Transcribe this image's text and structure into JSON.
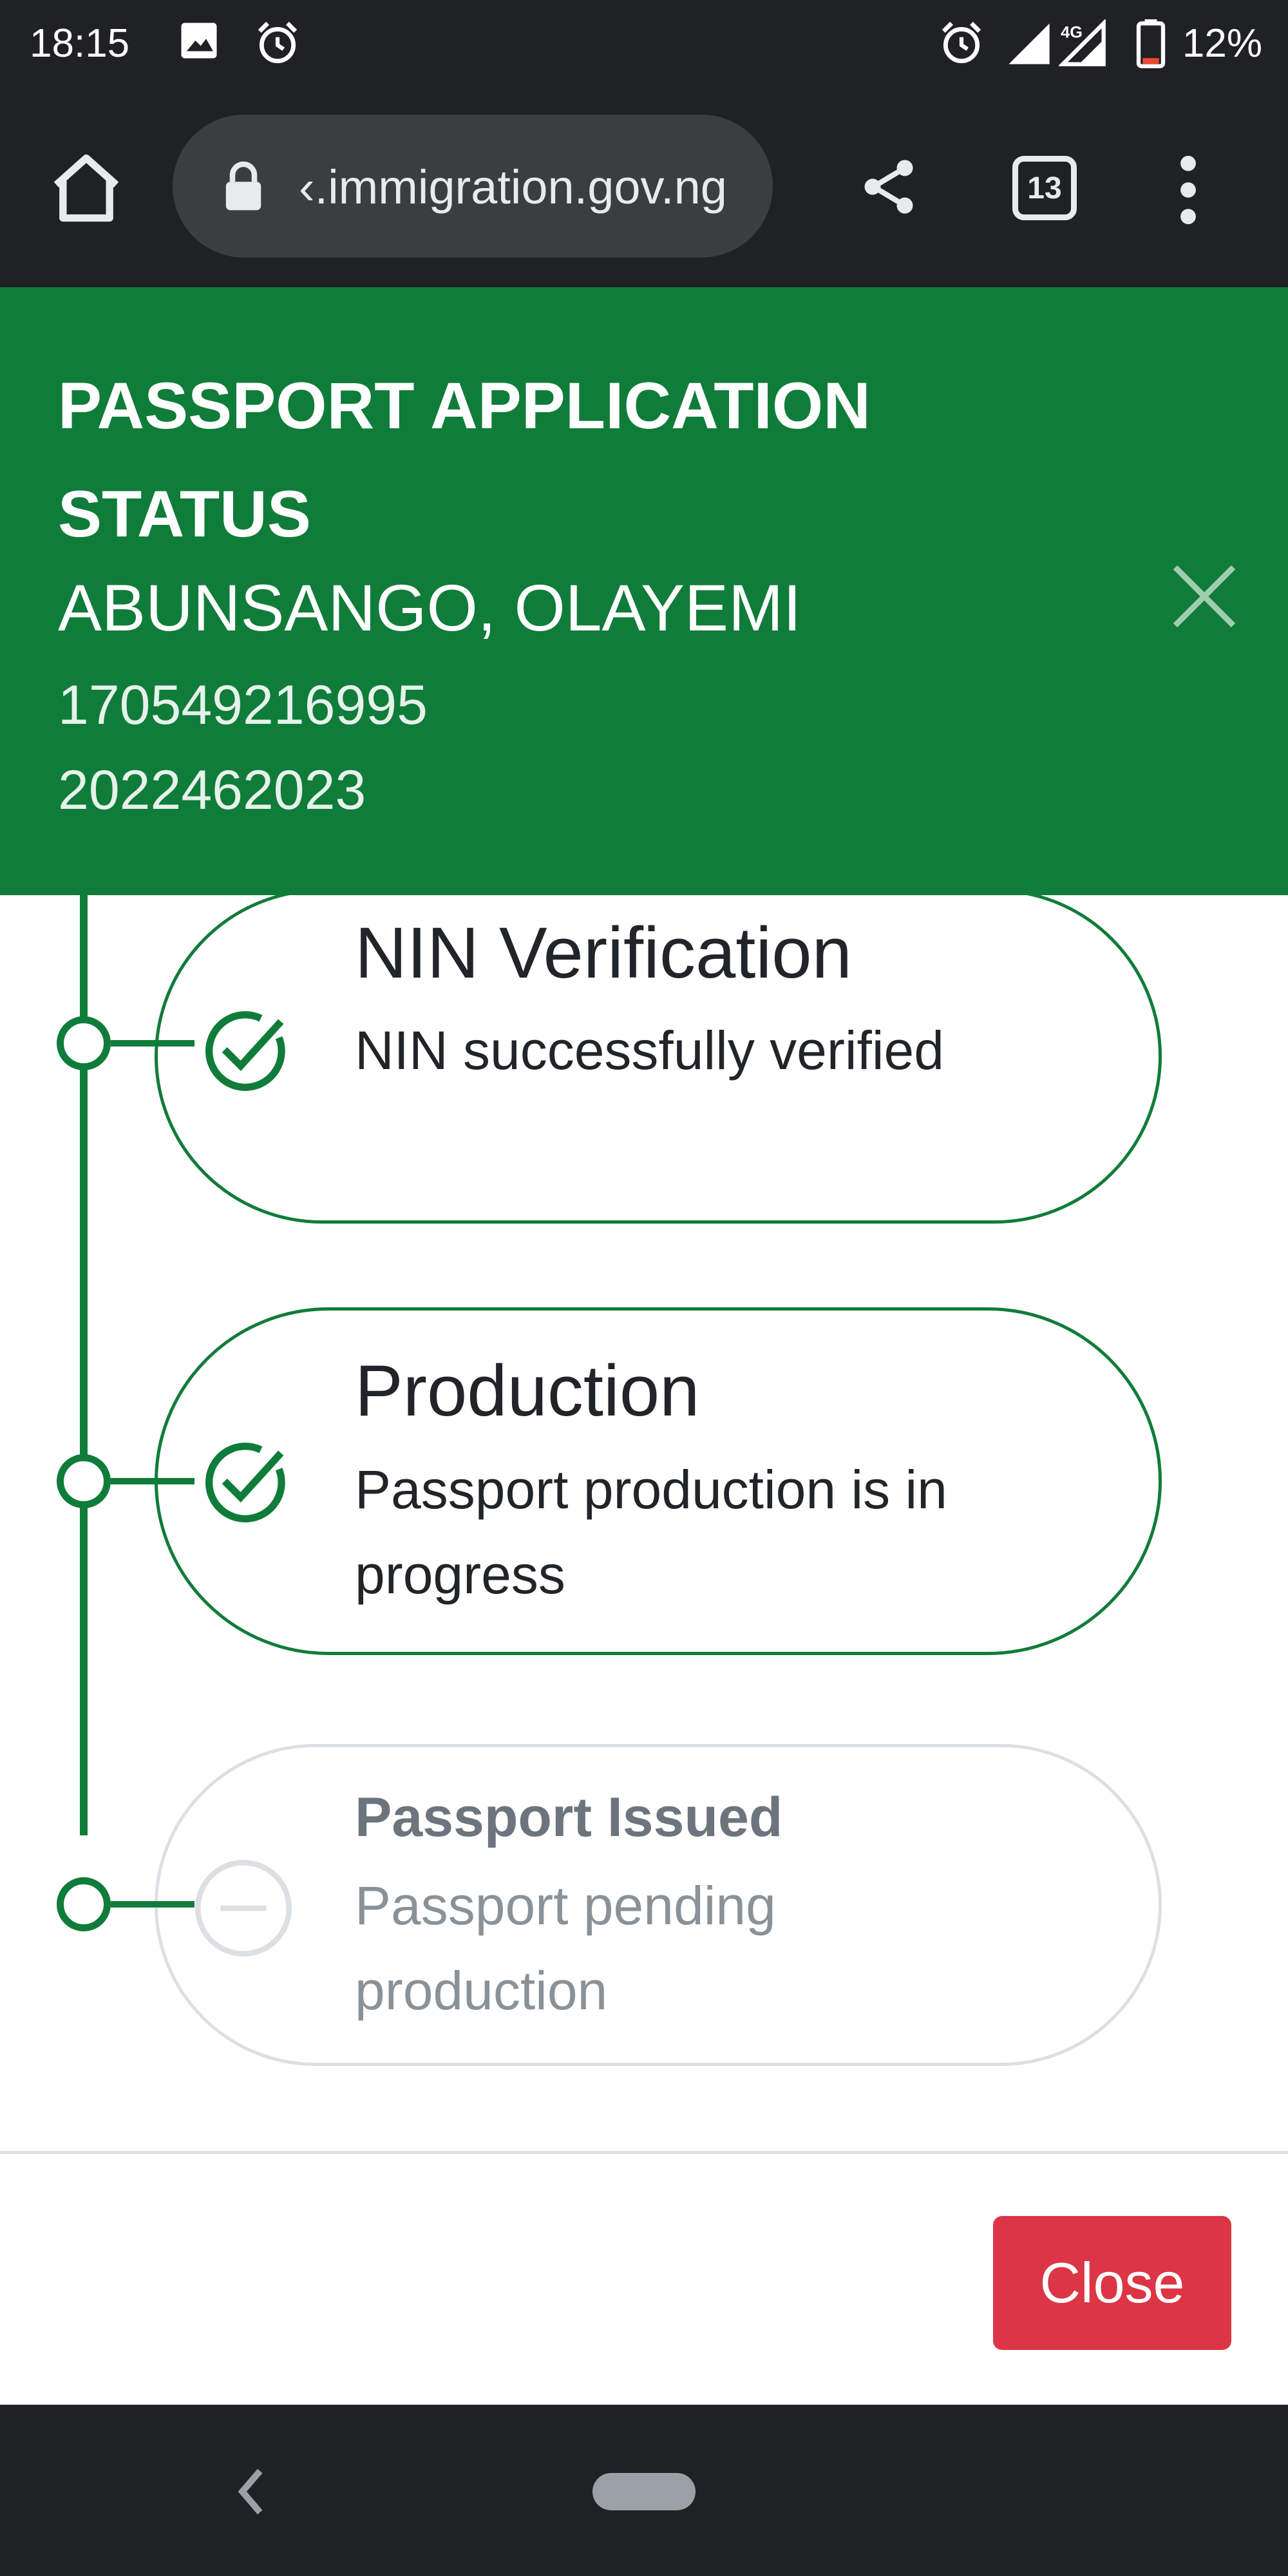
{
  "status_bar": {
    "time": "18:15",
    "battery": "12%",
    "network": "4G",
    "icons": [
      "image-icon",
      "alarm-icon",
      "alarm-icon",
      "signal-icon",
      "signal-4g-icon",
      "battery-icon"
    ]
  },
  "browser": {
    "url": "‹.immigration.gov.ng",
    "tab_count": "13",
    "icons": [
      "home-icon",
      "lock-icon",
      "share-icon",
      "tabs-icon",
      "more-vert-icon"
    ]
  },
  "modal": {
    "title": "PASSPORT APPLICATION STATUS",
    "applicant_name": "ABUNSANGO, OLAYEMI",
    "reference_1": "170549216995",
    "reference_2": "2022462023",
    "close_icon": "close-icon",
    "header_color": "#107c3a"
  },
  "timeline": {
    "steps": [
      {
        "title": "NIN Verification",
        "description": "NIN successfully verified",
        "status": "complete",
        "icon": "check-circle-icon"
      },
      {
        "title": "Production",
        "description": "Passport production is in progress",
        "status": "complete",
        "icon": "check-circle-icon"
      },
      {
        "title": "Passport Issued",
        "description": "Passport pending production",
        "status": "pending",
        "icon": "minus-circle-icon"
      }
    ]
  },
  "footer": {
    "close_label": "Close",
    "close_color": "#dc3545"
  },
  "nav_bar": {
    "icons": [
      "back-icon",
      "home-pill-icon"
    ]
  }
}
